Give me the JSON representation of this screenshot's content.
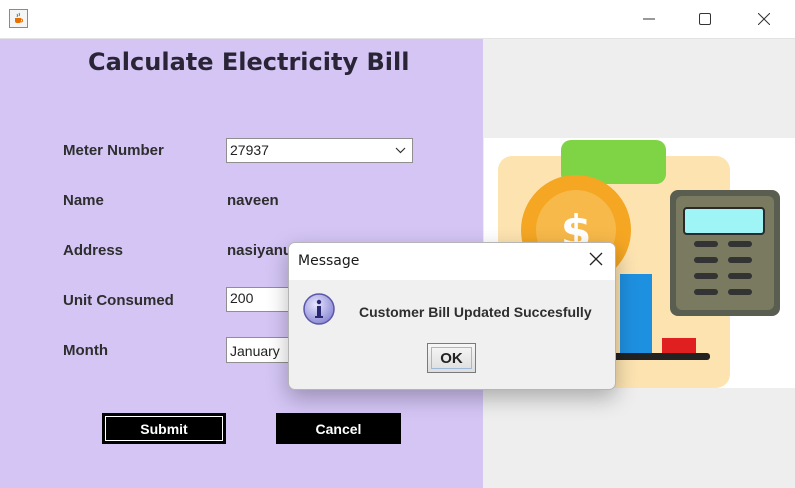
{
  "window": {
    "title": "",
    "app_icon": "java-cup-icon",
    "controls": [
      "minimize-icon",
      "maximize-icon",
      "close-icon"
    ]
  },
  "form": {
    "title": "Calculate Electricity Bill",
    "fields": {
      "meter_number": {
        "label": "Meter Number",
        "value": "27937"
      },
      "name": {
        "label": "Name",
        "value": "naveen"
      },
      "address": {
        "label": "Address",
        "value": "nasiyanu"
      },
      "unit_consumed": {
        "label": "Unit Consumed",
        "value": "200"
      },
      "month": {
        "label": "Month",
        "value": "January"
      }
    },
    "submit_label": "Submit",
    "cancel_label": "Cancel"
  },
  "dialog": {
    "title": "Message",
    "message": "Customer Bill Updated Succesfully",
    "ok_label": "OK",
    "icon": "info-icon"
  },
  "illustration": {
    "icon": "bill-calculator-illustration"
  },
  "colors": {
    "panel": "#d4c5f5",
    "button": "#000000",
    "dialog": "#f0f0f0"
  }
}
